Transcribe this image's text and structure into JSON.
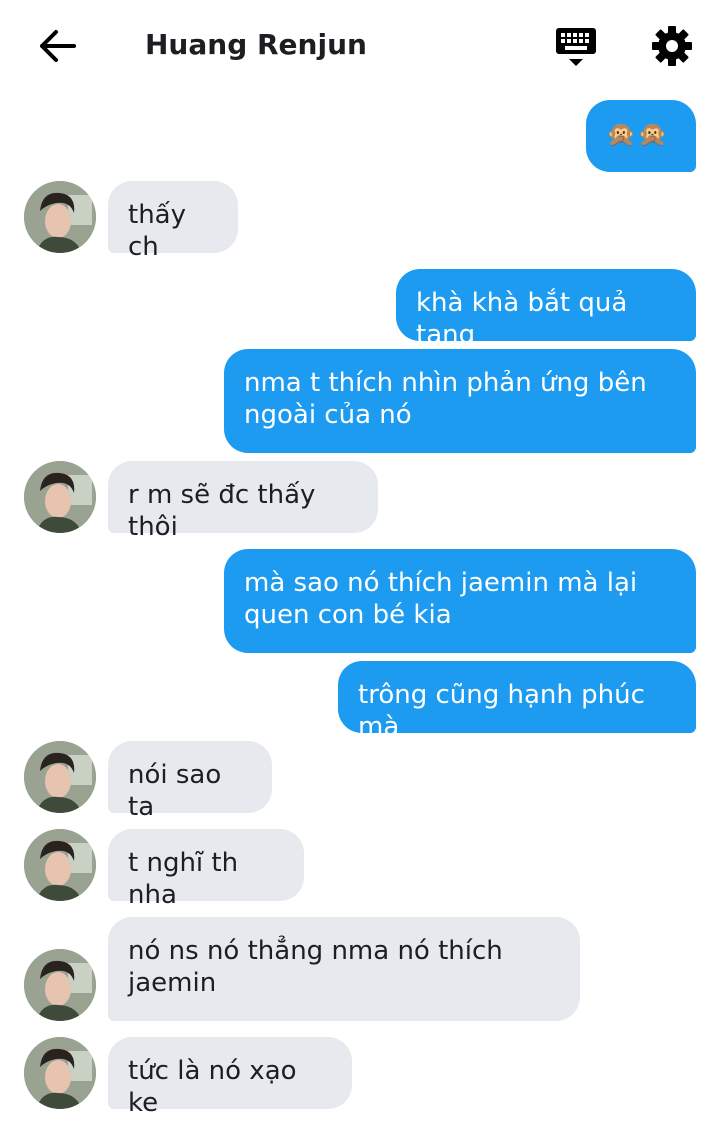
{
  "header": {
    "title": "Huang Renjun"
  },
  "icons": {
    "back": "back-arrow-icon",
    "keyboard": "keyboard-icon",
    "settings": "gear-icon"
  },
  "colors": {
    "outgoing": "#1d9bf0",
    "incoming": "#e6e9ed",
    "text": "#1c1e21"
  },
  "messages": [
    {
      "side": "out",
      "text": "🙊🙊"
    },
    {
      "side": "in",
      "text": "thấy ch"
    },
    {
      "side": "out",
      "text": "khà khà bắt quả tang"
    },
    {
      "side": "out",
      "text": "nma t thích nhìn phản ứng bên\nngoài của nó"
    },
    {
      "side": "in",
      "text": "r m sẽ đc thấy thôi"
    },
    {
      "side": "out",
      "text": "mà sao nó thích jaemin mà lại\nquen con bé kia"
    },
    {
      "side": "out",
      "text": "trông cũng hạnh phúc mà"
    },
    {
      "side": "in",
      "text": "nói sao ta"
    },
    {
      "side": "in",
      "text": "t nghĩ th nha"
    },
    {
      "side": "in",
      "text": "nó ns nó thẳng nma nó thích\njaemin"
    },
    {
      "side": "in",
      "text": "tức là nó xạo ke"
    }
  ]
}
